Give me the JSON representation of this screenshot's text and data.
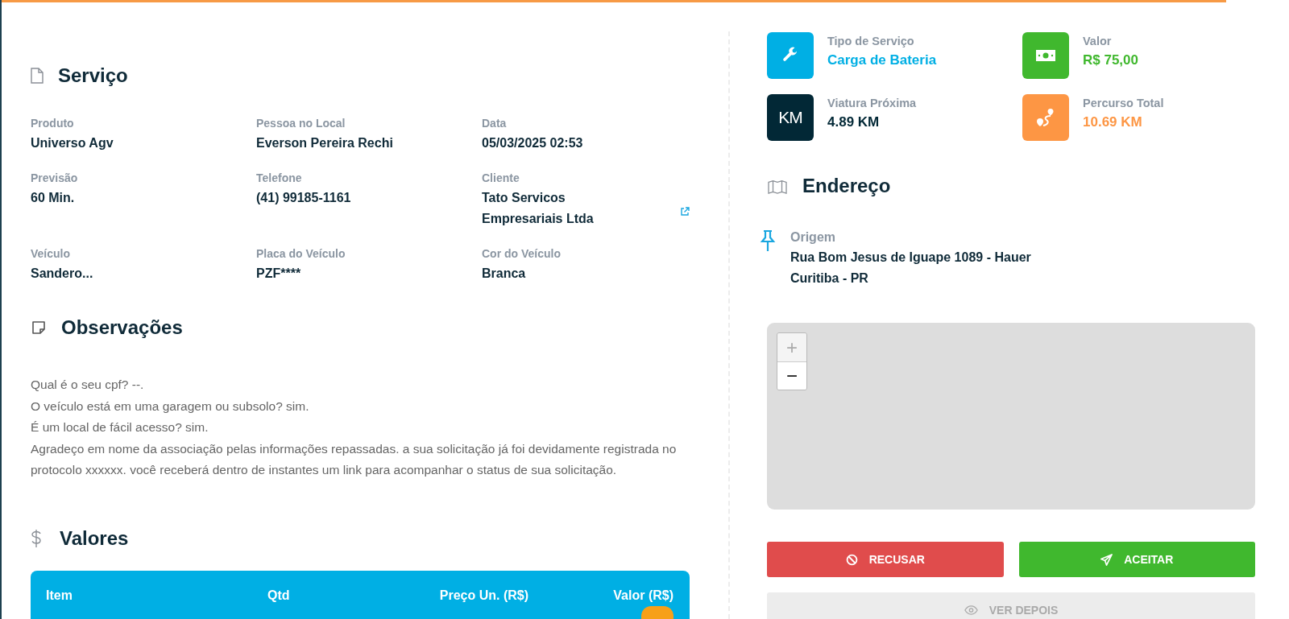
{
  "servico": {
    "title": "Serviço",
    "fields": [
      {
        "label": "Produto",
        "value": "Universo Agv"
      },
      {
        "label": "Pessoa no Local",
        "value": "Everson Pereira Rechi"
      },
      {
        "label": "Data",
        "value": "05/03/2025 02:53"
      },
      {
        "label": "Previsão",
        "value": "60 Min."
      },
      {
        "label": "Telefone",
        "value": "(41) 99185-1161"
      },
      {
        "label": "Cliente",
        "value": "Tato Servicos Empresariais Ltda",
        "link": true
      },
      {
        "label": "Veículo",
        "value": "Sandero..."
      },
      {
        "label": "Placa do Veículo",
        "value": "PZF****"
      },
      {
        "label": "Cor do Veículo",
        "value": "Branca"
      }
    ]
  },
  "observacoes": {
    "title": "Observações",
    "lines": [
      "Qual é o seu cpf? --.",
      "O veículo está em uma garagem ou subsolo? sim.",
      "É um local de fácil acesso? sim.",
      "Agradeço em nome da associação pelas informações repassadas. a sua solicitação já foi devidamente registrada no protocolo xxxxxx. você receberá dentro de instantes um link para acompanhar o status de sua solicitação."
    ]
  },
  "valores": {
    "title": "Valores",
    "columns": [
      "Item",
      "Qtd",
      "Preço Un. (R$)",
      "Valor (R$)"
    ]
  },
  "stats": [
    {
      "kind": "wrench",
      "label": "Tipo de Serviço",
      "value": "Carga de Bateria",
      "color": "#00afe4"
    },
    {
      "kind": "money",
      "label": "Valor",
      "value": "R$ 75,00",
      "color": "#40b82e"
    },
    {
      "kind": "km",
      "icon_text": "KM",
      "label": "Viatura Próxima",
      "value": "4.89 KM",
      "color": "#022836"
    },
    {
      "kind": "route",
      "label": "Percurso Total",
      "value": "10.69 KM",
      "color": "#fd9644"
    }
  ],
  "endereco": {
    "title": "Endereço",
    "origin_label": "Origem",
    "address_lines": [
      "Rua Bom Jesus de Iguape 1089 - Hauer",
      "Curitiba - PR"
    ]
  },
  "map": {
    "zoom_in": {
      "label": "+",
      "disabled": true
    },
    "zoom_out": {
      "label": "−",
      "disabled": false
    }
  },
  "actions": [
    {
      "kind": "refuse",
      "label": "RECUSAR",
      "disabled": false
    },
    {
      "kind": "accept",
      "label": "ACEITAR",
      "disabled": false
    },
    {
      "kind": "later",
      "label": "VER DEPOIS",
      "disabled": true
    }
  ]
}
